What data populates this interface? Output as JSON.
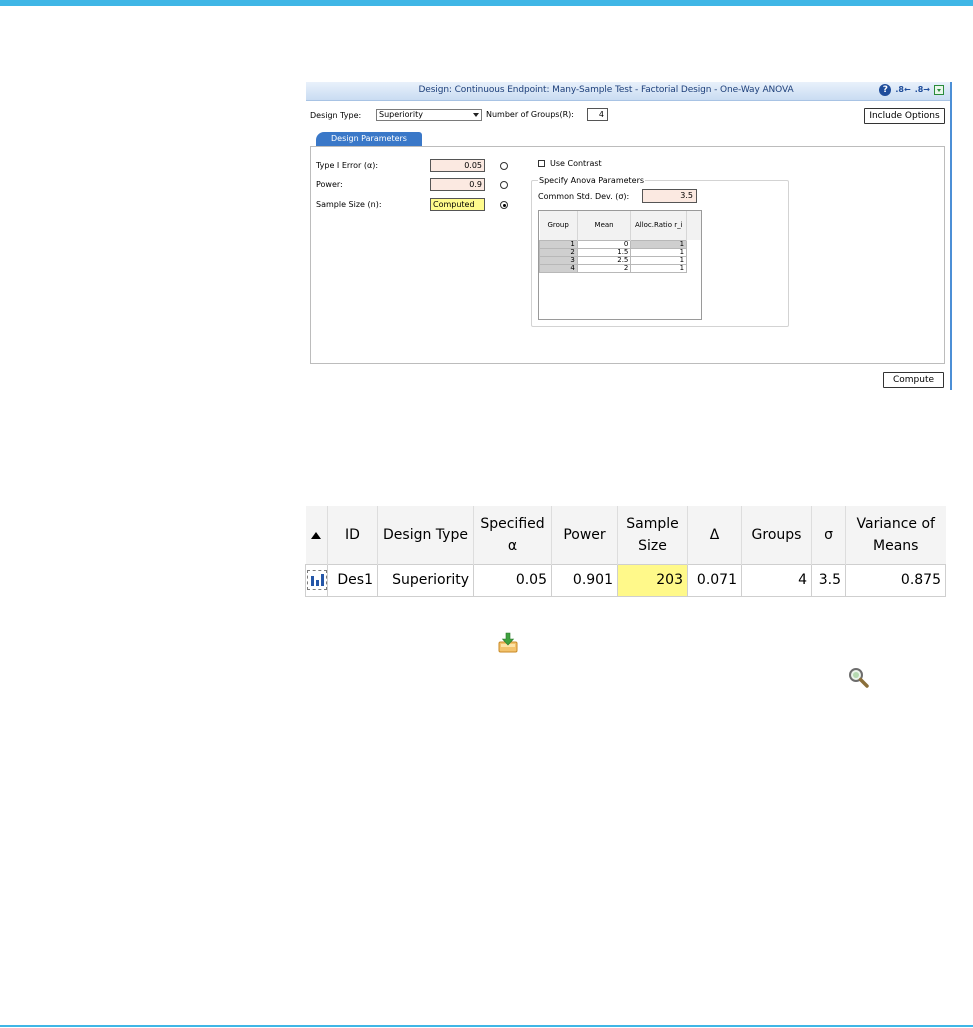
{
  "dialog": {
    "title": "Design: Continuous Endpoint: Many-Sample Test - Factorial Design - One-Way ANOVA",
    "help_icon": "?",
    "decimal_icons": [
      ".8←",
      ".8→"
    ],
    "design_type_label": "Design Type:",
    "design_type_value": "Superiority",
    "groups_label": "Number of Groups(R):",
    "groups_value": "4",
    "include_options_label": "Include Options",
    "tab_label": "Design Parameters",
    "type1_label": "Type I Error (α):",
    "type1_value": "0.05",
    "power_label": "Power:",
    "power_value": "0.9",
    "sample_size_label": "Sample Size (n):",
    "sample_size_value": "Computed",
    "use_contrast_label": "Use Contrast",
    "anova_group_label": "Specify Anova Parameters",
    "common_sd_label": "Common Std. Dev. (σ):",
    "common_sd_value": "3.5",
    "grid_headers": [
      "Group",
      "Mean",
      "Alloc.Ratio r_i"
    ],
    "grid_rows": [
      {
        "group": "1",
        "mean": "0",
        "alloc": "1"
      },
      {
        "group": "2",
        "mean": "1.5",
        "alloc": "1"
      },
      {
        "group": "3",
        "mean": "2.5",
        "alloc": "1"
      },
      {
        "group": "4",
        "mean": "2",
        "alloc": "1"
      }
    ],
    "compute_label": "Compute"
  },
  "results": {
    "headers": [
      "ID",
      "Design Type",
      "Specified α",
      "Power",
      "Sample Size",
      "Δ",
      "Groups",
      "σ",
      "Variance of Means"
    ],
    "row": {
      "id": "Des1",
      "design_type": "Superiority",
      "specified_alpha": "0.05",
      "power": "0.901",
      "sample_size": "203",
      "delta": "0.071",
      "groups": "4",
      "sigma": "3.5",
      "variance_of_means": "0.875"
    }
  },
  "colors": {
    "accent_rule": "#3fb6e6",
    "tab_blue": "#3a78c8",
    "computed_yellow": "#fff98a",
    "input_pink": "#fbe9e1"
  },
  "icons": {
    "save_output": "save-to-library-icon",
    "details": "magnify-icon"
  }
}
